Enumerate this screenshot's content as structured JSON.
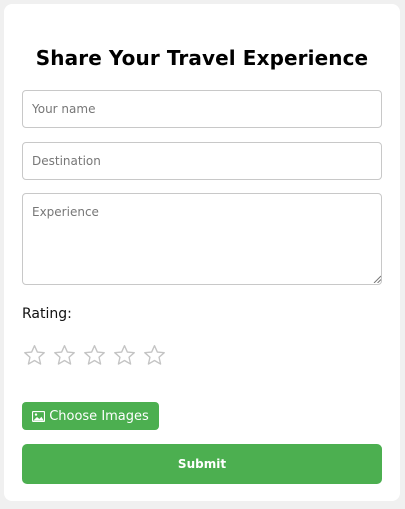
{
  "form": {
    "title": "Share Your Travel Experience",
    "name_placeholder": "Your name",
    "destination_placeholder": "Destination",
    "experience_placeholder": "Experience",
    "rating_label": "Rating:",
    "rating_value": 0,
    "rating_max": 5,
    "choose_images_label": "Choose Images",
    "submit_label": "Submit"
  },
  "icons": {
    "star": "star-outline-icon",
    "images": "image-icon"
  },
  "colors": {
    "accent": "#4caf50",
    "star_empty": "#c4c4c4"
  }
}
